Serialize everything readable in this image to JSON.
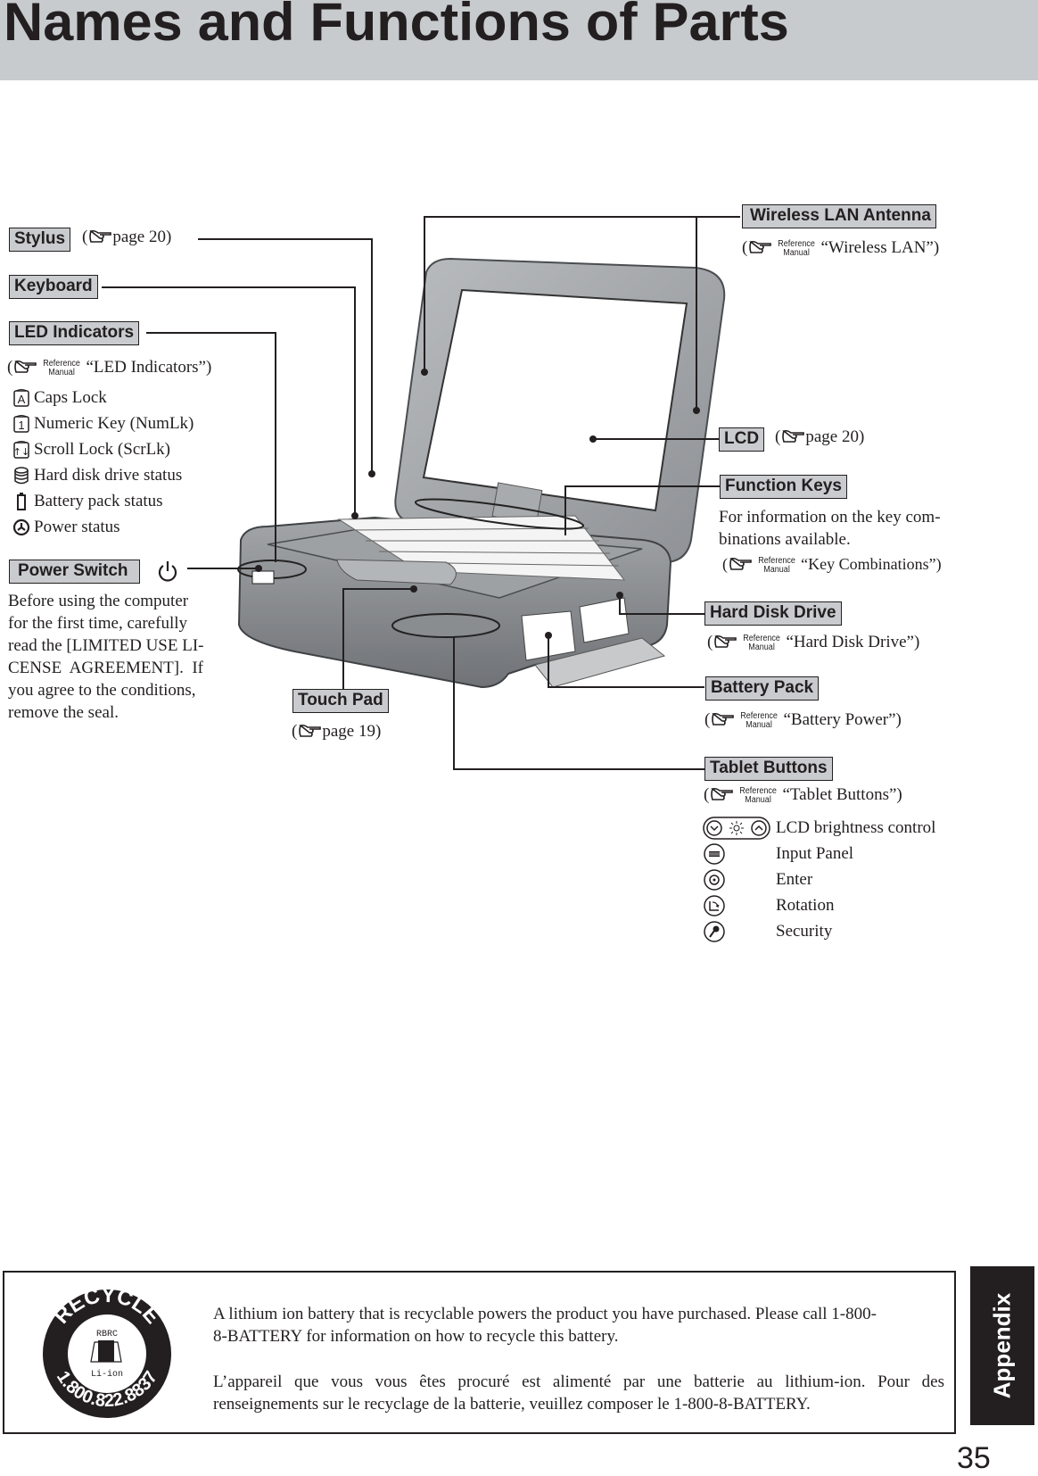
{
  "page": {
    "title": "Names and Functions of Parts",
    "page_number": "35",
    "section_tab": "Appendix"
  },
  "common": {
    "ref_line1": "Reference",
    "ref_line2": "Manual",
    "pointer_icon": "pointing-hand-icon"
  },
  "parts": {
    "stylus": {
      "label": "Stylus",
      "ref": "page 20",
      "open": "(",
      "close": ")"
    },
    "keyboard": {
      "label": "Keyboard"
    },
    "led_indicators": {
      "label": "LED Indicators",
      "ref": "“LED Indicators”)",
      "open": "(",
      "items": [
        {
          "icon": "caps-lock-icon",
          "text": "Caps Lock"
        },
        {
          "icon": "numeric-key-icon",
          "text": "Numeric Key (NumLk)"
        },
        {
          "icon": "scroll-lock-icon",
          "text": "Scroll Lock (ScrLk)"
        },
        {
          "icon": "hard-disk-icon",
          "text": "Hard disk drive status"
        },
        {
          "icon": "battery-icon",
          "text": "Battery pack status"
        },
        {
          "icon": "power-status-icon",
          "text": "Power status"
        }
      ]
    },
    "power_switch": {
      "label": "Power Switch",
      "icon": "power-icon",
      "description": "Before using the computer for the first time, carefully read the [LIMITED USE LICENSE AGREEMENT]. If you agree to the conditions, remove the seal.",
      "lines": [
        "Before using the computer",
        "for the first time, carefully",
        "read the [LIMITED USE LI-",
        "CENSE  AGREEMENT].  If",
        "you agree to the conditions,",
        "remove the seal."
      ]
    },
    "touch_pad": {
      "label": "Touch Pad",
      "ref": "page 19",
      "open": "(",
      "close": ")"
    },
    "wireless_lan": {
      "label": "Wireless LAN Antenna",
      "ref": "“Wireless LAN”)",
      "open": "("
    },
    "lcd": {
      "label": "LCD",
      "ref": "page 20",
      "open": "(",
      "close": ")"
    },
    "function_keys": {
      "label": "Function Keys",
      "lines": [
        "For information on the key com-",
        "binations available."
      ],
      "ref": "“Key Combinations”)",
      "open": "("
    },
    "hard_disk_drive": {
      "label": "Hard Disk Drive",
      "ref": "“Hard Disk Drive”)",
      "open": "("
    },
    "battery_pack": {
      "label": "Battery Pack",
      "ref": "“Battery Power”)",
      "open": "("
    },
    "tablet_buttons": {
      "label": "Tablet Buttons",
      "ref": "“Tablet Buttons”)",
      "open": "(",
      "items": [
        {
          "icon": "lcd-brightness-icon",
          "text": "LCD brightness control"
        },
        {
          "icon": "input-panel-icon",
          "text": "Input Panel"
        },
        {
          "icon": "enter-icon",
          "text": "Enter"
        },
        {
          "icon": "rotation-icon",
          "text": "Rotation"
        },
        {
          "icon": "security-icon",
          "text": "Security"
        }
      ]
    }
  },
  "recycle": {
    "logo_top": "RECYCLE",
    "logo_org": "RBRC",
    "logo_type": "Li-ion",
    "logo_phone": "1.800.822.8837",
    "english_lines": [
      "A lithium ion battery that is recyclable powers the product you have purchased.  Please call 1-800-",
      "8-BATTERY for information on how to recycle this battery."
    ],
    "french_lines": [
      "L’appareil que vous vous êtes procuré est alimenté par une batterie au lithium-ion. Pour des",
      "renseignements sur le recyclage de la batterie, veuillez composer le 1-800-8-BATTERY."
    ]
  },
  "colors": {
    "header_gray": "#c8cbce",
    "label_gray": "#c9cbce",
    "ink": "#231f20"
  }
}
